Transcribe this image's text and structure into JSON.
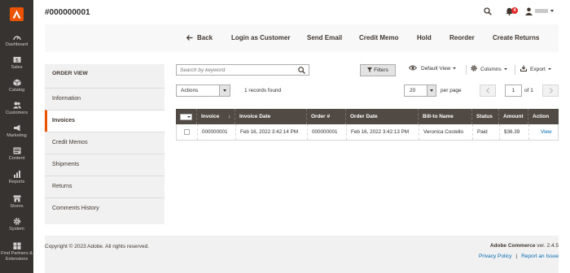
{
  "app": {
    "page_title": "#000000001",
    "notification_count": "4",
    "accent": "#eb5202"
  },
  "sidebar": {
    "items": [
      {
        "label": "Dashboard",
        "icon": "dashboard-icon"
      },
      {
        "label": "Sales",
        "icon": "dollar-icon"
      },
      {
        "label": "Catalog",
        "icon": "box-icon"
      },
      {
        "label": "Customers",
        "icon": "customers-icon"
      },
      {
        "label": "Marketing",
        "icon": "megaphone-icon"
      },
      {
        "label": "Content",
        "icon": "content-icon"
      },
      {
        "label": "Reports",
        "icon": "bar-chart-icon"
      },
      {
        "label": "Stores",
        "icon": "store-icon"
      },
      {
        "label": "System",
        "icon": "gear-icon"
      },
      {
        "label": "Find Partners & Extensions",
        "icon": "partners-icon"
      }
    ]
  },
  "actionbar": {
    "back": "Back",
    "login_as_customer": "Login as Customer",
    "send_email": "Send Email",
    "credit_memo": "Credit Memo",
    "hold": "Hold",
    "reorder": "Reorder",
    "create_returns": "Create Returns"
  },
  "order_view": {
    "title": "Order View",
    "tabs": [
      {
        "label": "Information",
        "active": false
      },
      {
        "label": "Invoices",
        "active": true
      },
      {
        "label": "Credit Memos",
        "active": false
      },
      {
        "label": "Shipments",
        "active": false
      },
      {
        "label": "Returns",
        "active": false
      },
      {
        "label": "Comments History",
        "active": false
      }
    ]
  },
  "grid_toolbar": {
    "search_placeholder": "Search by keyword",
    "filters": "Filters",
    "default_view": "Default View",
    "columns": "Columns",
    "export": "Export",
    "actions": "Actions",
    "records_found": "1 records found",
    "per_page_value": "20",
    "per_page_label": "per page",
    "current_page": "1",
    "of_pages": "of 1"
  },
  "grid": {
    "columns": [
      "Invoice",
      "Invoice Date",
      "Order #",
      "Order Date",
      "Bill-to Name",
      "Status",
      "Amount",
      "Action"
    ],
    "rows": [
      {
        "invoice": "000000001",
        "invoice_date": "Feb 16, 2022 3:42:14 PM",
        "order_no": "000000001",
        "order_date": "Feb 16, 2022 3:42:13 PM",
        "bill_to": "Veronica Costello",
        "status": "Paid",
        "amount": "$36.39",
        "action": "View"
      }
    ]
  },
  "footer": {
    "copyright": "Copyright © 2023 Adobe. All rights reserved.",
    "product": "Adobe Commerce",
    "version": "ver. 2.4.5",
    "privacy": "Privacy Policy",
    "report": "Report an Issue"
  }
}
